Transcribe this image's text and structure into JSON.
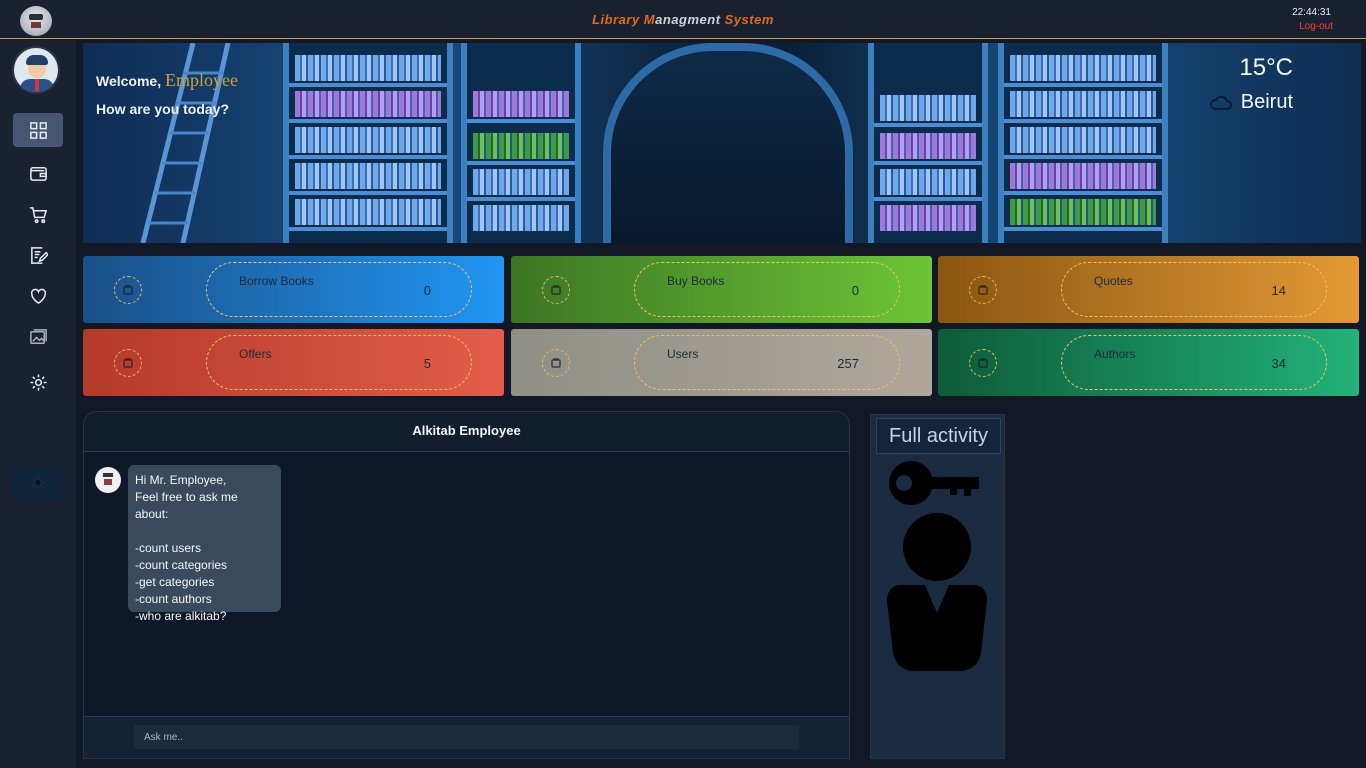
{
  "header": {
    "title_parts": [
      {
        "text": "L",
        "accent": true
      },
      {
        "text": "ibrary ",
        "accent": true
      },
      {
        "text": "M",
        "accent": true
      },
      {
        "text": "anagment ",
        "accent": false
      },
      {
        "text": "S",
        "accent": true
      },
      {
        "text": "ystem",
        "accent": true
      }
    ],
    "clock": "22:44:31",
    "logout": "Log-out"
  },
  "sidebar": {
    "items": [
      {
        "name": "dashboard",
        "icon": "grid-icon",
        "active": true
      },
      {
        "name": "wallet",
        "icon": "wallet-icon",
        "active": false
      },
      {
        "name": "cart",
        "icon": "cart-icon",
        "active": false
      },
      {
        "name": "edit",
        "icon": "edit-icon",
        "active": false
      },
      {
        "name": "favorites",
        "icon": "heart-icon",
        "active": false
      },
      {
        "name": "gallery",
        "icon": "image-icon",
        "active": false
      },
      {
        "name": "settings",
        "icon": "gear-icon",
        "active": false
      }
    ],
    "theme_icon": "sun-icon"
  },
  "banner": {
    "welcome_prefix": "Welcome, ",
    "welcome_name": "Employee",
    "greeting": "How are you today?",
    "temperature": "15°C",
    "city": "Beirut"
  },
  "cards": [
    {
      "label": "Borrow Books",
      "value": "0",
      "icon": "borrow-icon",
      "from": "#1a4f86",
      "to": "#2196f3"
    },
    {
      "label": "Buy Books",
      "value": "0",
      "icon": "buy-icon",
      "from": "#3d7524",
      "to": "#6cc536"
    },
    {
      "label": "Quotes",
      "value": "14",
      "icon": "quote-icon",
      "from": "#8a5612",
      "to": "#e39a36"
    },
    {
      "label": "Offers",
      "value": "5",
      "icon": "offer-icon",
      "from": "#b43a2a",
      "to": "#e35d4a"
    },
    {
      "label": "Users",
      "value": "257",
      "icon": "users-icon",
      "from": "#8f8f86",
      "to": "#b0a79c"
    },
    {
      "label": "Authors",
      "value": "34",
      "icon": "authors-icon",
      "from": "#0e5b3a",
      "to": "#22b27a"
    }
  ],
  "chat": {
    "title": "Alkitab Employee",
    "bot_message": [
      "Hi Mr. Employee,",
      "Feel free to ask me about:",
      "",
      "-count users",
      "-count categories",
      "-get categories",
      "-count authors",
      "-who are alkitab?"
    ],
    "input_placeholder": "Ask me.."
  },
  "activity": {
    "button_label": "Full activity"
  }
}
